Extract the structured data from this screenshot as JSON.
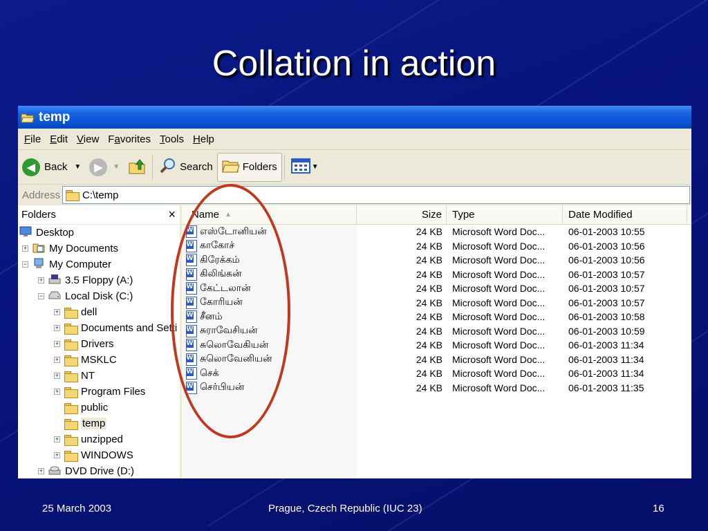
{
  "slide": {
    "title": "Collation in action",
    "footer_date": "25 March 2003",
    "footer_place": "Prague, Czech Republic (IUC 23)",
    "page_number": "16"
  },
  "window": {
    "title": "temp",
    "menu": [
      "File",
      "Edit",
      "View",
      "Favorites",
      "Tools",
      "Help"
    ],
    "toolbar": {
      "back": "Back",
      "search": "Search",
      "folders": "Folders"
    },
    "address": {
      "label": "Address",
      "value": "C:\\temp"
    }
  },
  "folders_pane": {
    "title": "Folders",
    "close": "×",
    "tree": [
      {
        "label": "Desktop"
      },
      {
        "label": "My Documents"
      },
      {
        "label": "My Computer"
      },
      {
        "label": "3.5 Floppy (A:)"
      },
      {
        "label": "Local Disk (C:)"
      },
      {
        "label": "dell"
      },
      {
        "label": "Documents and Setti"
      },
      {
        "label": "Drivers"
      },
      {
        "label": "MSKLC"
      },
      {
        "label": "NT"
      },
      {
        "label": "Program Files"
      },
      {
        "label": "public"
      },
      {
        "label": "temp"
      },
      {
        "label": "unzipped"
      },
      {
        "label": "WINDOWS"
      },
      {
        "label": "DVD Drive (D:)"
      }
    ]
  },
  "file_list": {
    "columns": {
      "name": "Name",
      "size": "Size",
      "type": "Type",
      "date": "Date Modified"
    },
    "rows": [
      {
        "name": "எஸ்டோனியன்",
        "size": "24 KB",
        "type": "Microsoft Word Doc...",
        "date": "06-01-2003 10:55"
      },
      {
        "name": "காகோச்",
        "size": "24 KB",
        "type": "Microsoft Word Doc...",
        "date": "06-01-2003 10:56"
      },
      {
        "name": "கிரேக்கம்",
        "size": "24 KB",
        "type": "Microsoft Word Doc...",
        "date": "06-01-2003 10:56"
      },
      {
        "name": "கிலிங்கன்",
        "size": "24 KB",
        "type": "Microsoft Word Doc...",
        "date": "06-01-2003 10:57"
      },
      {
        "name": "கேட்டலான்",
        "size": "24 KB",
        "type": "Microsoft Word Doc...",
        "date": "06-01-2003 10:57"
      },
      {
        "name": "கோரியன்",
        "size": "24 KB",
        "type": "Microsoft Word Doc...",
        "date": "06-01-2003 10:57"
      },
      {
        "name": "சீனம்",
        "size": "24 KB",
        "type": "Microsoft Word Doc...",
        "date": "06-01-2003 10:58"
      },
      {
        "name": "சுராவேசியன்",
        "size": "24 KB",
        "type": "Microsoft Word Doc...",
        "date": "06-01-2003 10:59"
      },
      {
        "name": "சுலொவேகியன்",
        "size": "24 KB",
        "type": "Microsoft Word Doc...",
        "date": "06-01-2003 11:34"
      },
      {
        "name": "சுலொவேனியன்",
        "size": "24 KB",
        "type": "Microsoft Word Doc...",
        "date": "06-01-2003 11:34"
      },
      {
        "name": "செக்",
        "size": "24 KB",
        "type": "Microsoft Word Doc...",
        "date": "06-01-2003 11:34"
      },
      {
        "name": "செர்பியன்",
        "size": "24 KB",
        "type": "Microsoft Word Doc...",
        "date": "06-01-2003 11:35"
      }
    ]
  },
  "colors": {
    "slide_background": "#0b1c8a",
    "titlebar_blue": "#0a55d8",
    "chrome": "#ece9d8",
    "annotation_oval": "#c0391e"
  }
}
